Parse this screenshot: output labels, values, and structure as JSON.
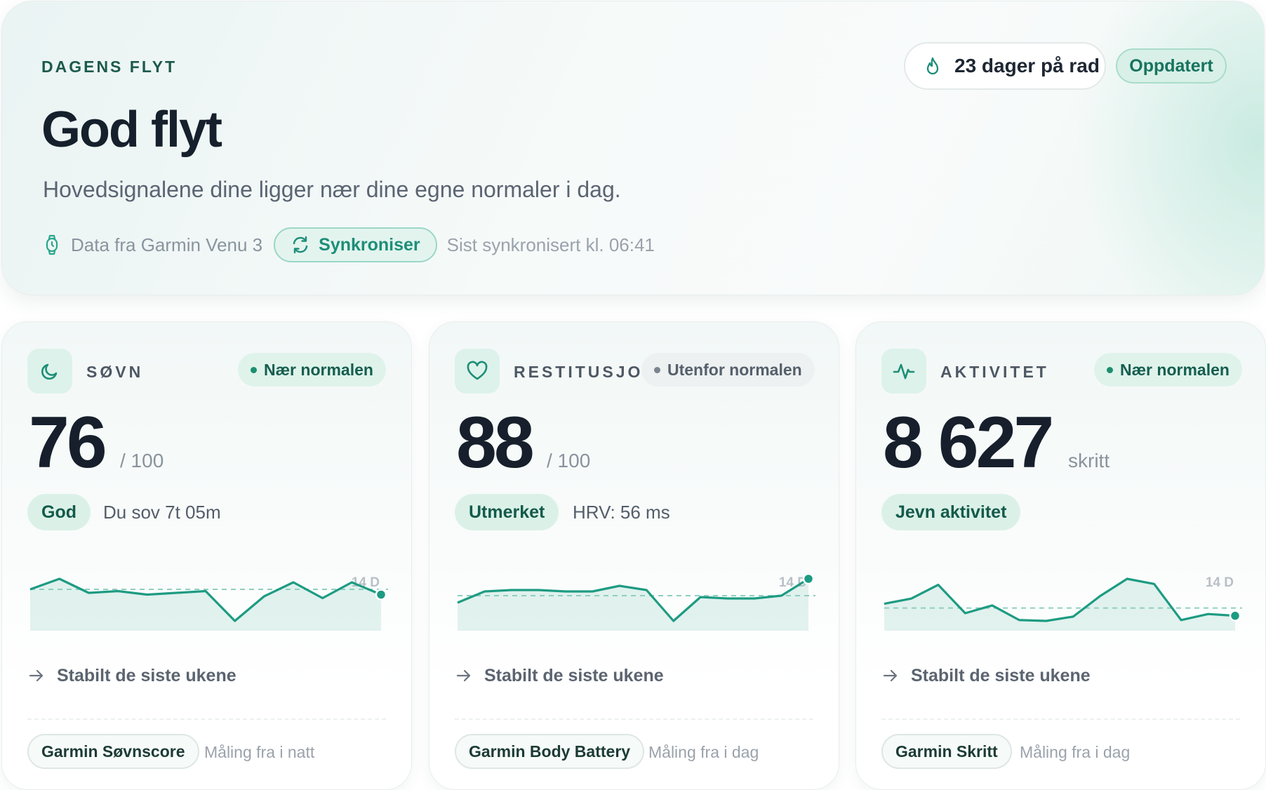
{
  "hero": {
    "eyebrow": "DAGENS FLYT",
    "title": "God flyt",
    "subtitle": "Hovedsignalene dine ligger nær dine egne normaler i dag.",
    "source_text": "Data fra Garmin Venu 3",
    "sync_label": "Synkroniser",
    "last_sync": "Sist synkronisert kl. 06:41",
    "streak": "23 dager på rad",
    "updated": "Oppdatert"
  },
  "colors": {
    "accent": "#1d9b82",
    "accent_soft": "#dff3eb",
    "text_dark": "#161f2b",
    "muted": "#8a939d"
  },
  "cards": [
    {
      "icon": "moon-icon",
      "label": "SØVN",
      "status": "Nær normalen",
      "status_kind": "good",
      "value": "76",
      "unit": "/ 100",
      "quality": "God",
      "detail": "Du sov 7t 05m",
      "spark_label": "14 D",
      "spark_values": [
        73,
        79,
        71,
        72,
        70,
        71,
        72,
        55,
        69,
        77,
        68,
        77,
        70
      ],
      "spark_baseline": 73,
      "trend": "Stabilt de siste ukene",
      "source": "Garmin Søvnscore",
      "measure": "Måling fra i natt"
    },
    {
      "icon": "heart-icon",
      "label": "RESTITUSJON",
      "status": "Utenfor normalen",
      "status_kind": "neutral",
      "value": "88",
      "unit": "/ 100",
      "quality": "Utmerket",
      "detail": "HRV: 56 ms",
      "spark_label": "14 D",
      "spark_values": [
        71,
        79,
        80,
        80,
        79,
        79,
        83,
        80,
        58,
        75,
        74,
        74,
        76,
        88
      ],
      "spark_baseline": 76,
      "trend": "Stabilt de siste ukene",
      "source": "Garmin Body Battery",
      "measure": "Måling fra i dag"
    },
    {
      "icon": "pulse-icon",
      "label": "AKTIVITET",
      "status": "Nær normalen",
      "status_kind": "good",
      "value": "8 627",
      "unit": "skritt",
      "quality": "Jevn aktivitet",
      "detail": "",
      "spark_label": "14 D",
      "spark_values": [
        7300,
        7900,
        9500,
        6200,
        7100,
        5400,
        5300,
        5800,
        8200,
        10200,
        9600,
        5400,
        6100,
        5900
      ],
      "spark_baseline": 6800,
      "trend": "Stabilt de siste ukene",
      "source": "Garmin Skritt",
      "measure": "Måling fra i dag"
    }
  ]
}
